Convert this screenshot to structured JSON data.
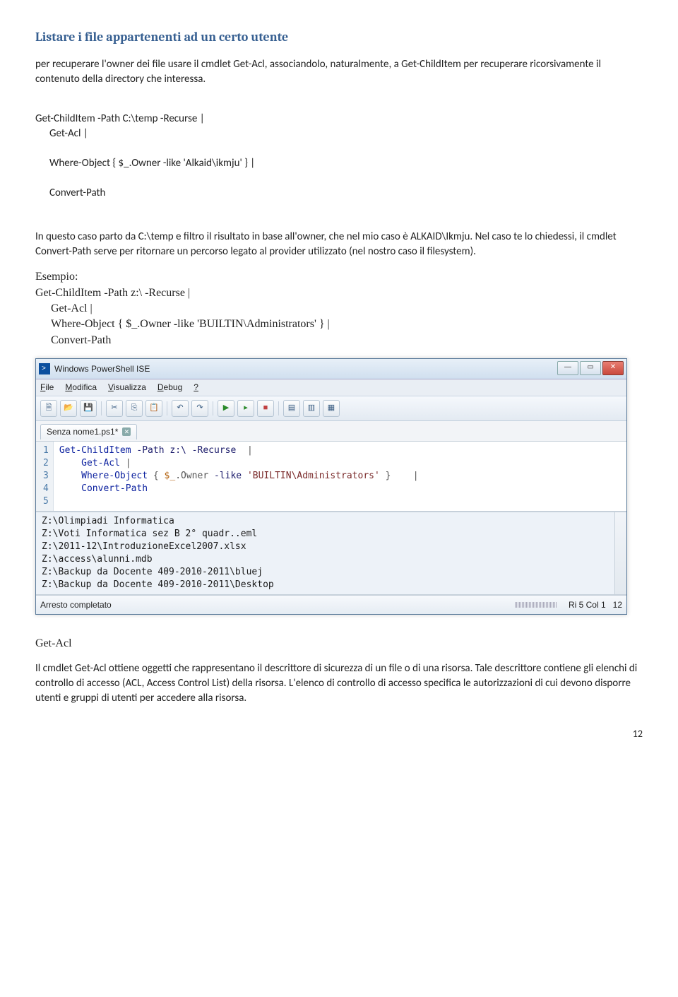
{
  "heading": "Listare i file appartenenti ad un certo utente",
  "para1": "per recuperare l'owner dei file usare il cmdlet Get-Acl, associandolo, naturalmente, a Get-ChildItem per recuperare ricorsivamente il contenuto della directory che interessa.",
  "code1": {
    "l1": "Get-ChildItem -Path C:\\temp -Recurse |",
    "l2": "Get-Acl |",
    "l3": "Where-Object { $_.Owner -like 'Alkaid\\ikmju' } |",
    "l4": "Convert-Path"
  },
  "para2": "In questo caso parto da C:\\temp e filtro il risultato in base all'owner, che nel mio caso è ALKAID\\Ikmju. Nel caso te lo chiedessi, il cmdlet Convert-Path serve per ritornare un percorso legato al provider utilizzato (nel nostro caso il filesystem).",
  "esempio_label": "Esempio:",
  "code2": {
    "l1": "Get-ChildItem -Path z:\\ -Recurse |",
    "l2": "Get-Acl |",
    "l3": "Where-Object { $_.Owner -like 'BUILTIN\\Administrators' }    |",
    "l4": "Convert-Path"
  },
  "window": {
    "title": "Windows PowerShell ISE",
    "menu": {
      "file": "File",
      "modifica": "Modifica",
      "visualizza": "Visualizza",
      "debug": "Debug",
      "help": "?"
    },
    "tab": "Senza nome1.ps1*",
    "gutter": "1\n2\n3\n4\n5",
    "editor": {
      "l1a": "Get-ChildItem",
      "l1b": " -Path ",
      "l1c": "z:\\",
      "l1d": " -Recurse  ",
      "l1e": "|",
      "l2a": "Get-Acl",
      "l2b": " |",
      "l3a": "Where-Object",
      "l3b": " { ",
      "l3c": "$_",
      "l3d": ".Owner ",
      "l3e": "-like",
      "l3f": " 'BUILTIN\\Administrators'",
      "l3g": " }    ",
      "l3h": "|",
      "l4a": "Convert-Path"
    },
    "output": {
      "o1": "Z:\\Olimpiadi Informatica",
      "o2": "Z:\\Voti Informatica sez B 2° quadr..eml",
      "o3": "Z:\\2011-12\\IntroduzioneExcel2007.xlsx",
      "o4": "Z:\\access\\alunni.mdb",
      "o5": "Z:\\Backup da Docente 409-2010-2011\\bluej",
      "o6": "Z:\\Backup da Docente 409-2010-2011\\Desktop"
    },
    "status_left": "Arresto completato",
    "status_pos": "Ri 5  Col 1",
    "status_zoom": "12"
  },
  "getacl_head": "Get-Acl",
  "para3": "Il cmdlet Get-Acl ottiene oggetti che rappresentano il descrittore di sicurezza di un file o di una risorsa. Tale descrittore contiene gli elenchi di controllo di accesso (ACL, Access Control List) della risorsa. L'elenco di controllo di accesso specifica le autorizzazioni di cui devono disporre utenti e gruppi di utenti per accedere alla risorsa.",
  "pagenum": "12"
}
